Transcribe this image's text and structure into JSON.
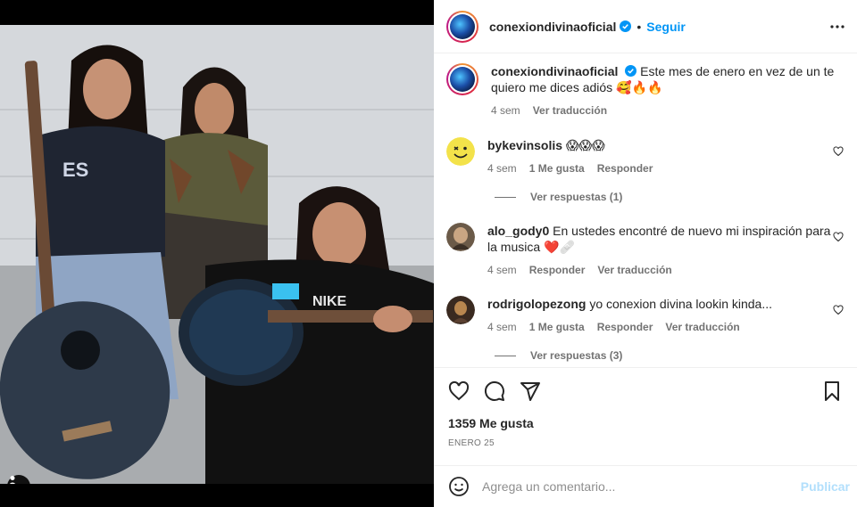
{
  "post": {
    "username": "conexiondivinaoficial",
    "follow_label": "Seguir",
    "separator": "•",
    "more_icon": "more-horizontal-icon"
  },
  "caption": {
    "username": "conexiondivinaoficial",
    "text": "Este mes de enero en vez de un te quiero me dices adiós 🥰🔥🔥",
    "time": "4 sem",
    "translate": "Ver traducción"
  },
  "comments": [
    {
      "username": "bykevinsolis",
      "text": "😱😱😱",
      "time": "4 sem",
      "likes": "1 Me gusta",
      "reply": "Responder",
      "view_replies": "Ver respuestas (1)"
    },
    {
      "username": "alo_gody0",
      "text": "En ustedes encontré de nuevo mi inspiración para la musica ❤️🩹",
      "time": "4 sem",
      "reply": "Responder",
      "translate": "Ver traducción"
    },
    {
      "username": "rodrigolopezong",
      "text": "yo conexion divina lookin kinda...",
      "time": "4 sem",
      "likes": "1 Me gusta",
      "reply": "Responder",
      "translate": "Ver traducción",
      "view_replies": "Ver respuestas (3)"
    }
  ],
  "actions": {
    "likes": "1359 Me gusta",
    "date": "ENERO 25"
  },
  "composer": {
    "placeholder": "Agrega un comentario...",
    "post_label": "Publicar"
  },
  "colors": {
    "accent": "#0095f6",
    "muted": "#737373",
    "post_disabled": "#b2dffc"
  }
}
